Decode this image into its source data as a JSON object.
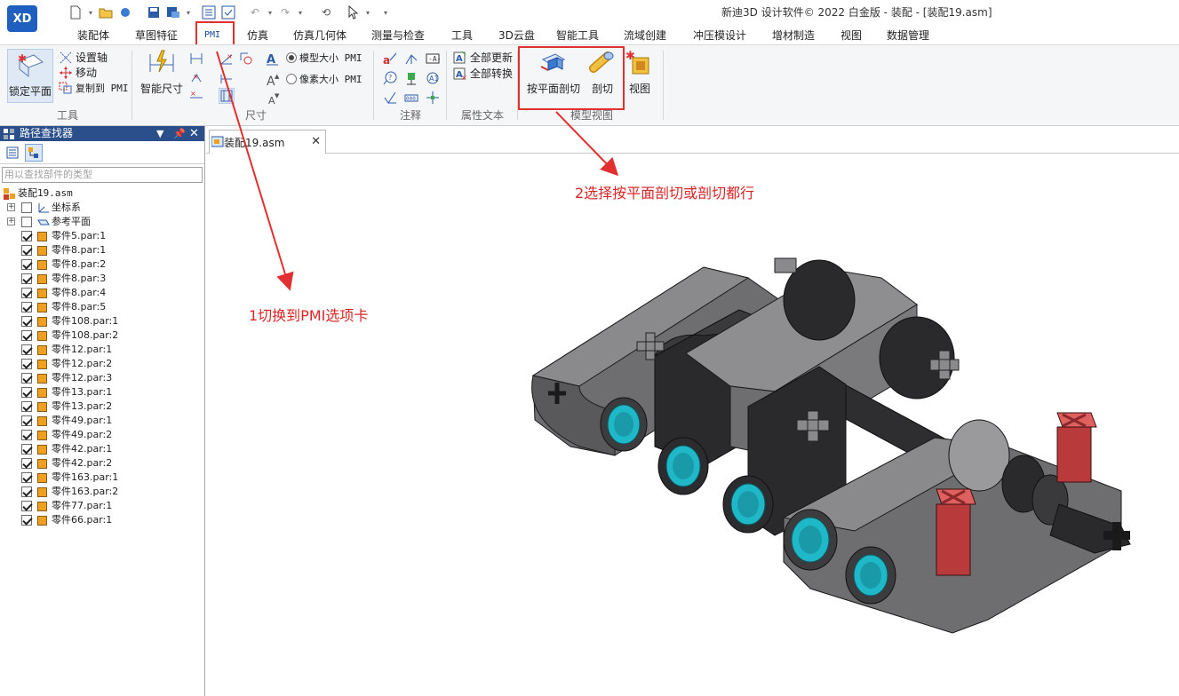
{
  "app": {
    "logo_text": "XD",
    "window_title": "新迪3D 设计软件© 2022 白金版 - 装配 - [装配19.asm]"
  },
  "menu": {
    "tabs": [
      "装配体",
      "草图特征",
      "PMI",
      "仿真",
      "仿真几何体",
      "测量与检查",
      "工具",
      "3D云盘",
      "智能工具",
      "流域创建",
      "冲压模设计",
      "增材制造",
      "视图",
      "数据管理"
    ],
    "active": "PMI"
  },
  "ribbon": {
    "tools": {
      "label": "工具",
      "lock_plane": "锁定平面",
      "set_axis": "设置轴",
      "move": "移动",
      "copy_to_pmi": "复制到 PMI"
    },
    "dimension": {
      "label": "尺寸",
      "smart_dim": "智能尺寸",
      "model_size": "模型大小 PMI",
      "pixel_size": "像素大小 PMI",
      "model_size_selected": true
    },
    "annotation": {
      "label": "注释"
    },
    "property_text": {
      "label": "属性文本",
      "update_all": "全部更新",
      "convert_all": "全部转换"
    },
    "model_view": {
      "label": "模型视图",
      "plane_section": "按平面剖切",
      "section": "剖切",
      "view": "视图"
    }
  },
  "pathfinder": {
    "title": "路径查找器",
    "search_placeholder": "用以查找部件的类型",
    "root": "装配19.asm",
    "folders": [
      "坐标系",
      "参考平面"
    ],
    "parts": [
      "零件5.par:1",
      "零件8.par:1",
      "零件8.par:2",
      "零件8.par:3",
      "零件8.par:4",
      "零件8.par:5",
      "零件108.par:1",
      "零件108.par:2",
      "零件12.par:1",
      "零件12.par:2",
      "零件12.par:3",
      "零件13.par:1",
      "零件13.par:2",
      "零件49.par:1",
      "零件49.par:2",
      "零件42.par:1",
      "零件42.par:2",
      "零件163.par:1",
      "零件163.par:2",
      "零件77.par:1",
      "零件66.par:1"
    ]
  },
  "document": {
    "tab_label": "装配19.asm"
  },
  "annotations": {
    "step1": "1切换到PMI选项卡",
    "step2": "2选择按平面剖切或剖切都行"
  },
  "colors": {
    "annotation_red": "#e03030",
    "panel_header": "#2b4f8a",
    "part_gray": "#6e6e70",
    "dark_part": "#2a2a2c",
    "cyan_bushing": "#1fb8c8",
    "red_pin": "#b83a3a"
  }
}
